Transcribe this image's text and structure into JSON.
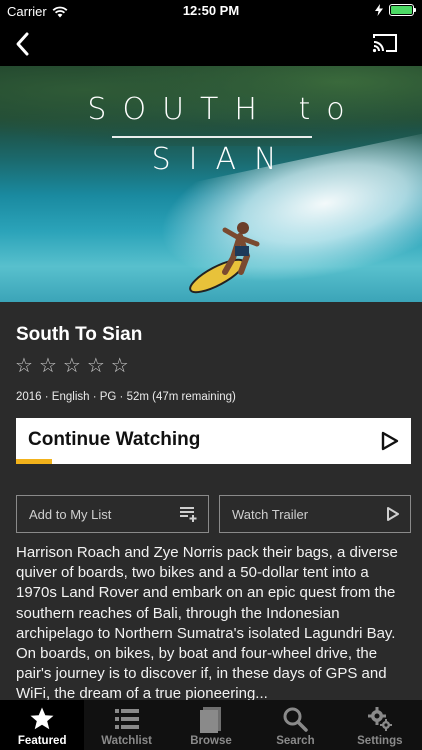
{
  "status_bar": {
    "carrier": "Carrier",
    "time": "12:50 PM",
    "battery_color": "#4cd964"
  },
  "nav": {
    "back_icon": "chevron-left-icon",
    "cast_icon": "cast-icon"
  },
  "hero": {
    "title_line1": "SOUTH to",
    "title_line2": "SIAN"
  },
  "movie": {
    "title": "South To Sian",
    "rating_stars": 5,
    "rating_value": 0,
    "meta": "2016 · English · PG · 52m (47m remaining)",
    "continue_label": "Continue Watching",
    "progress_fraction": 0.09,
    "progress_color": "#f2b21b",
    "add_to_list_label": "Add to My List",
    "watch_trailer_label": "Watch Trailer",
    "description": "Harrison Roach and Zye Norris pack their bags, a diverse quiver of boards, two bikes and a 50-dollar tent into a 1970s Land Rover and embark on an epic quest from the southern reaches of Bali, through the Indonesian archipelago to Northern Sumatra's isolated Lagundri Bay. On boards, on bikes, by boat and four-wheel drive, the pair's journey is to discover if, in these days of GPS and WiFi, the dream of a true pioneering..."
  },
  "tabs": [
    {
      "label": "Featured",
      "icon": "star-icon",
      "active": true
    },
    {
      "label": "Watchlist",
      "icon": "list-icon",
      "active": false
    },
    {
      "label": "Browse",
      "icon": "browse-icon",
      "active": false
    },
    {
      "label": "Search",
      "icon": "search-icon",
      "active": false
    },
    {
      "label": "Settings",
      "icon": "gear-icon",
      "active": false
    }
  ]
}
